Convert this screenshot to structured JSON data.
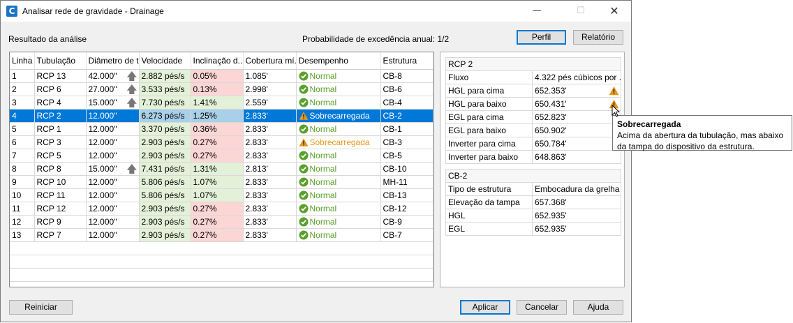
{
  "window": {
    "title": "Analisar rede de gravidade - Drainage",
    "app_icon_letter": "C"
  },
  "header": {
    "results_label": "Resultado da análise",
    "probability_label": "Probabilidade de excedência anual: 1/2",
    "profile_button": "Perfil",
    "report_button": "Relatório"
  },
  "grid": {
    "columns": [
      "Linha",
      "Tubulação",
      "Diâmetro de t...",
      "Velocidade",
      "Inclinação d...",
      "Cobertura mí...",
      "Desempenho",
      "Estrutura"
    ],
    "selected_row": 3,
    "rows": [
      {
        "line": "1",
        "pipe": "RCP 13",
        "diameter": "42.000\"",
        "arrow": true,
        "velocity": "2.882 pés/s",
        "slope": "0.05%",
        "slope_flag": "red",
        "cover": "1.085'",
        "perf": "Normal",
        "perf_state": "normal",
        "structure": "CB-8"
      },
      {
        "line": "2",
        "pipe": "RCP 6",
        "diameter": "27.000\"",
        "arrow": true,
        "velocity": "3.533 pés/s",
        "slope": "0.13%",
        "slope_flag": "red",
        "cover": "2.998'",
        "perf": "Normal",
        "perf_state": "normal",
        "structure": "CB-6"
      },
      {
        "line": "3",
        "pipe": "RCP 4",
        "diameter": "15.000\"",
        "arrow": true,
        "velocity": "7.730 pés/s",
        "slope": "1.41%",
        "slope_flag": "green",
        "cover": "2.559'",
        "perf": "Normal",
        "perf_state": "normal",
        "structure": "CB-4"
      },
      {
        "line": "4",
        "pipe": "RCP 2",
        "diameter": "12.000\"",
        "arrow": false,
        "velocity": "6.273 pés/s",
        "slope": "1.25%",
        "slope_flag": "green",
        "cover": "2.833'",
        "perf": "Sobrecarregada",
        "perf_state": "warning",
        "structure": "CB-2"
      },
      {
        "line": "5",
        "pipe": "RCP 1",
        "diameter": "12.000\"",
        "arrow": false,
        "velocity": "3.370 pés/s",
        "slope": "0.36%",
        "slope_flag": "red",
        "cover": "2.833'",
        "perf": "Normal",
        "perf_state": "normal",
        "structure": "CB-1"
      },
      {
        "line": "6",
        "pipe": "RCP 3",
        "diameter": "12.000\"",
        "arrow": false,
        "velocity": "2.903 pés/s",
        "slope": "0.27%",
        "slope_flag": "red",
        "cover": "2.833'",
        "perf": "Sobrecarregada",
        "perf_state": "warning",
        "structure": "CB-3"
      },
      {
        "line": "7",
        "pipe": "RCP 5",
        "diameter": "12.000\"",
        "arrow": false,
        "velocity": "2.903 pés/s",
        "slope": "0.27%",
        "slope_flag": "red",
        "cover": "2.833'",
        "perf": "Normal",
        "perf_state": "normal",
        "structure": "CB-5"
      },
      {
        "line": "8",
        "pipe": "RCP 8",
        "diameter": "15.000\"",
        "arrow": true,
        "velocity": "7.431 pés/s",
        "slope": "1.31%",
        "slope_flag": "green",
        "cover": "2.813'",
        "perf": "Normal",
        "perf_state": "normal",
        "structure": "CB-10"
      },
      {
        "line": "9",
        "pipe": "RCP 10",
        "diameter": "12.000\"",
        "arrow": false,
        "velocity": "5.806 pés/s",
        "slope": "1.07%",
        "slope_flag": "green",
        "cover": "2.833'",
        "perf": "Normal",
        "perf_state": "normal",
        "structure": "MH-11"
      },
      {
        "line": "10",
        "pipe": "RCP 11",
        "diameter": "12.000\"",
        "arrow": false,
        "velocity": "5.806 pés/s",
        "slope": "1.07%",
        "slope_flag": "green",
        "cover": "2.833'",
        "perf": "Normal",
        "perf_state": "normal",
        "structure": "CB-13"
      },
      {
        "line": "11",
        "pipe": "RCP 12",
        "diameter": "12.000\"",
        "arrow": false,
        "velocity": "2.903 pés/s",
        "slope": "0.27%",
        "slope_flag": "red",
        "cover": "2.833'",
        "perf": "Normal",
        "perf_state": "normal",
        "structure": "CB-12"
      },
      {
        "line": "12",
        "pipe": "RCP 9",
        "diameter": "12.000\"",
        "arrow": false,
        "velocity": "2.903 pés/s",
        "slope": "0.27%",
        "slope_flag": "red",
        "cover": "2.833'",
        "perf": "Normal",
        "perf_state": "normal",
        "structure": "CB-9"
      },
      {
        "line": "13",
        "pipe": "RCP 7",
        "diameter": "12.000\"",
        "arrow": false,
        "velocity": "2.903 pés/s",
        "slope": "0.27%",
        "slope_flag": "red",
        "cover": "2.833'",
        "perf": "Normal",
        "perf_state": "normal",
        "structure": "CB-7"
      }
    ]
  },
  "pipe_panel": {
    "title": "RCP 2",
    "rows": [
      {
        "label": "Fluxo",
        "value": "4.322 pés cúbicos por ...",
        "warning": false
      },
      {
        "label": "HGL para cima",
        "value": "652.353'",
        "warning": true
      },
      {
        "label": "HGL para baixo",
        "value": "650.431'",
        "warning": true
      },
      {
        "label": "EGL para cima",
        "value": "652.823'",
        "warning": false
      },
      {
        "label": "EGL para baixo",
        "value": "650.902'",
        "warning": false
      },
      {
        "label": "Inverter para cima",
        "value": "650.784'",
        "warning": false
      },
      {
        "label": "Inverter para baixo",
        "value": "648.863'",
        "warning": false
      }
    ]
  },
  "structure_panel": {
    "title": "CB-2",
    "rows": [
      {
        "label": "Tipo de estrutura",
        "value": "Embocadura da grelha"
      },
      {
        "label": "Elevação da tampa",
        "value": "657.368'"
      },
      {
        "label": "HGL",
        "value": "652.935'"
      },
      {
        "label": "EGL",
        "value": "652.935'"
      }
    ]
  },
  "tooltip": {
    "title": "Sobrecarregada",
    "line1": "Acima da abertura da tubulação, mas abaixo",
    "line2": "da tampa do dispositivo da estrutura."
  },
  "footer": {
    "reset_button": "Reiniciar",
    "apply_button": "Aplicar",
    "cancel_button": "Cancelar",
    "help_button": "Ajuda"
  },
  "colors": {
    "accent": "#0078d7",
    "normal": "#5aa02c",
    "warning": "#e8961a",
    "good_cell": "#e3f1d8",
    "bad_cell": "#fcd5d5"
  },
  "icons": [
    "app-icon",
    "minimize-icon",
    "maximize-icon",
    "close-icon",
    "arrow-up-icon",
    "check-circle-icon",
    "warning-triangle-icon",
    "mouse-cursor-icon"
  ]
}
